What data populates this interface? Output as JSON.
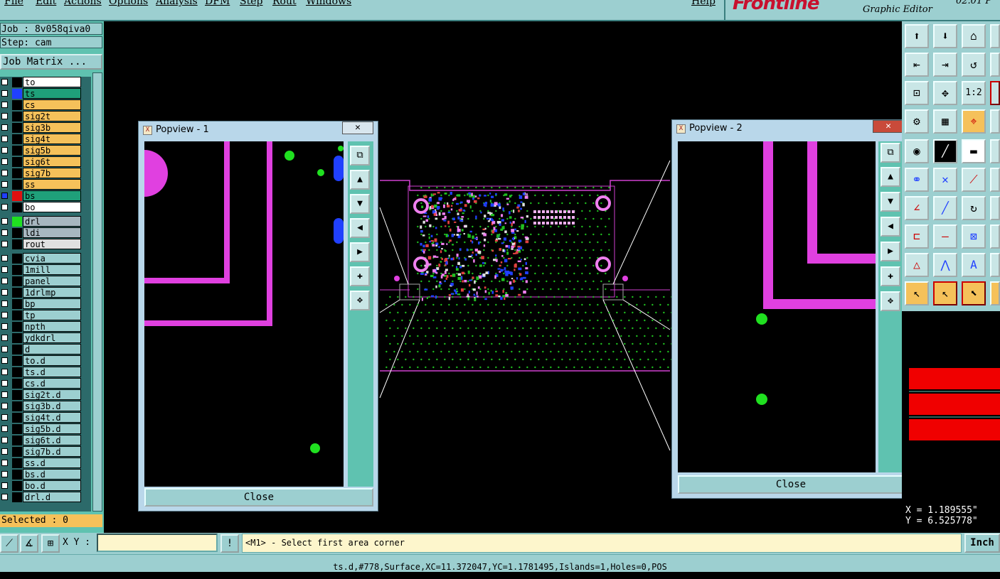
{
  "menu": {
    "items": [
      "File",
      "Edit",
      "Actions",
      "Options",
      "Analysis",
      "DFM",
      "Step",
      "Rout",
      "Windows"
    ],
    "help": "Help"
  },
  "brand": {
    "logo": "Frontline",
    "subtitle": "Graphic Editor",
    "version": "02.01 P"
  },
  "job": {
    "job_label": "Job : 8v058qiva0",
    "step_label": "Step: cam",
    "matrix_button": "Job Matrix ..."
  },
  "layers": [
    {
      "name": "to",
      "bg": "#ffffff",
      "swatch": "#000000",
      "checked": false
    },
    {
      "name": "ts",
      "bg": "#1fa07a",
      "swatch": "#2040ff",
      "checked": false
    },
    {
      "name": "cs",
      "bg": "#f5c15a",
      "swatch": "#000000",
      "checked": false
    },
    {
      "name": "sig2t",
      "bg": "#f5c15a",
      "swatch": "#000000",
      "checked": false
    },
    {
      "name": "sig3b",
      "bg": "#f5c15a",
      "swatch": "#000000",
      "checked": false
    },
    {
      "name": "sig4t",
      "bg": "#f5c15a",
      "swatch": "#000000",
      "checked": false
    },
    {
      "name": "sig5b",
      "bg": "#f5c15a",
      "swatch": "#000000",
      "checked": false
    },
    {
      "name": "sig6t",
      "bg": "#f5c15a",
      "swatch": "#000000",
      "checked": false
    },
    {
      "name": "sig7b",
      "bg": "#f5c15a",
      "swatch": "#000000",
      "checked": false
    },
    {
      "name": "ss",
      "bg": "#f5c15a",
      "swatch": "#000000",
      "checked": false
    },
    {
      "name": "bs",
      "bg": "#1fa07a",
      "swatch": "#e01010",
      "checked": true
    },
    {
      "name": "bo",
      "bg": "#ffffff",
      "swatch": "#000000",
      "checked": false
    },
    {
      "name": "drl",
      "bg": "#a7b7c0",
      "swatch": "#20e020",
      "checked": false
    },
    {
      "name": "ldi",
      "bg": "#a7b7c0",
      "swatch": "#000000",
      "checked": false
    },
    {
      "name": "rout",
      "bg": "#e0e0e0",
      "swatch": "#000000",
      "checked": false
    },
    {
      "name": "cvia",
      "bg": "#9ccfd0",
      "swatch": "#000000",
      "checked": false
    },
    {
      "name": "1mill",
      "bg": "#9ccfd0",
      "swatch": "#000000",
      "checked": false
    },
    {
      "name": "panel",
      "bg": "#9ccfd0",
      "swatch": "#000000",
      "checked": false
    },
    {
      "name": "1drlmp",
      "bg": "#9ccfd0",
      "swatch": "#000000",
      "checked": false
    },
    {
      "name": "bp",
      "bg": "#9ccfd0",
      "swatch": "#000000",
      "checked": false
    },
    {
      "name": "tp",
      "bg": "#9ccfd0",
      "swatch": "#000000",
      "checked": false
    },
    {
      "name": "npth",
      "bg": "#9ccfd0",
      "swatch": "#000000",
      "checked": false
    },
    {
      "name": "ydkdrl",
      "bg": "#9ccfd0",
      "swatch": "#000000",
      "checked": false
    },
    {
      "name": "d",
      "bg": "#9ccfd0",
      "swatch": "#000000",
      "checked": false
    },
    {
      "name": "to.d",
      "bg": "#9ccfd0",
      "swatch": "#000000",
      "checked": false
    },
    {
      "name": "ts.d",
      "bg": "#9ccfd0",
      "swatch": "#000000",
      "checked": false
    },
    {
      "name": "cs.d",
      "bg": "#9ccfd0",
      "swatch": "#000000",
      "checked": false
    },
    {
      "name": "sig2t.d",
      "bg": "#9ccfd0",
      "swatch": "#000000",
      "checked": false
    },
    {
      "name": "sig3b.d",
      "bg": "#9ccfd0",
      "swatch": "#000000",
      "checked": false
    },
    {
      "name": "sig4t.d",
      "bg": "#9ccfd0",
      "swatch": "#000000",
      "checked": false
    },
    {
      "name": "sig5b.d",
      "bg": "#9ccfd0",
      "swatch": "#000000",
      "checked": false
    },
    {
      "name": "sig6t.d",
      "bg": "#9ccfd0",
      "swatch": "#000000",
      "checked": false
    },
    {
      "name": "sig7b.d",
      "bg": "#9ccfd0",
      "swatch": "#000000",
      "checked": false
    },
    {
      "name": "ss.d",
      "bg": "#9ccfd0",
      "swatch": "#000000",
      "checked": false
    },
    {
      "name": "bs.d",
      "bg": "#9ccfd0",
      "swatch": "#000000",
      "checked": false
    },
    {
      "name": "bo.d",
      "bg": "#9ccfd0",
      "swatch": "#000000",
      "checked": false
    },
    {
      "name": "drl.d",
      "bg": "#9ccfd0",
      "swatch": "#000000",
      "checked": false
    }
  ],
  "selected_label": "Selected : 0",
  "popview1": {
    "title": "Popview - 1",
    "close_label": "Close"
  },
  "popview2": {
    "title": "Popview - 2",
    "close_label": "Close"
  },
  "command": {
    "xy_label": "X Y :",
    "xy_value": "",
    "prompt": "<M1> - Select first area corner",
    "unit": "Inch"
  },
  "coords": {
    "x": "X = 1.189555\"",
    "y": "Y = 6.525778\""
  },
  "status": "ts.d,#778,Surface,XC=11.372047,YC=1.1781495,Islands=1,Holes=0,POS",
  "colors": {
    "panel": "#9ccfd0",
    "teal": "#5fc2b0",
    "highlight": "#f5c15a",
    "trace": "#e040e0",
    "pad": "#20e020"
  }
}
